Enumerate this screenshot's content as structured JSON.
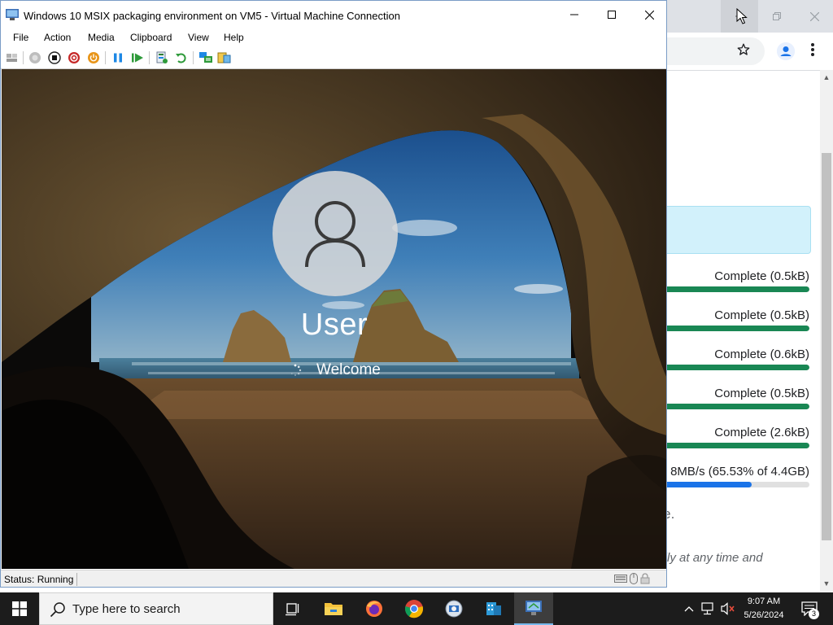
{
  "browser": {
    "scrollbar": {
      "up_arrow": "▲",
      "down_arrow": "▼"
    },
    "downloads": [
      {
        "status": "Complete (0.5kB)",
        "progress": 1.0
      },
      {
        "status": "Complete (0.5kB)",
        "progress": 1.0
      },
      {
        "status": "Complete (0.6kB)",
        "progress": 1.0
      },
      {
        "status": "Complete (0.5kB)",
        "progress": 1.0
      },
      {
        "status": "Complete (2.6kB)",
        "progress": 1.0
      },
      {
        "status": "8MB/s (65.53% of 4.4GB)",
        "progress": 0.6553
      }
    ],
    "partial_text_1": "are.",
    "partial_text_2": "ually at any time and",
    "colors": {
      "complete_bar": "#198754",
      "banner": "#d2f1fb"
    }
  },
  "vm": {
    "window_title": "Windows 10 MSIX packaging environment on VM5 - Virtual Machine Connection",
    "menu": [
      "File",
      "Action",
      "Media",
      "Clipboard",
      "View",
      "Help"
    ],
    "toolbar_icons": [
      "ctrl-alt-del-icon",
      "start-icon",
      "turn-off-icon",
      "shut-down-icon",
      "power-icon",
      "pause-icon",
      "resume-icon",
      "checkpoint-icon",
      "revert-icon",
      "enhanced-session-icon",
      "share-icon"
    ],
    "lock_screen": {
      "user_name": "User",
      "status_text": "Welcome"
    },
    "status_bar": {
      "status": "Status: Running"
    }
  },
  "taskbar": {
    "search_placeholder": "Type here to search",
    "apps": [
      "task-view-icon",
      "file-explorer-icon",
      "firefox-icon",
      "chrome-icon",
      "remote-desktop-icon",
      "hyper-v-manager-icon",
      "vm-connection-icon"
    ],
    "tray": {
      "time": "9:07 AM",
      "date": "5/26/2024",
      "notification_count": "3"
    }
  }
}
